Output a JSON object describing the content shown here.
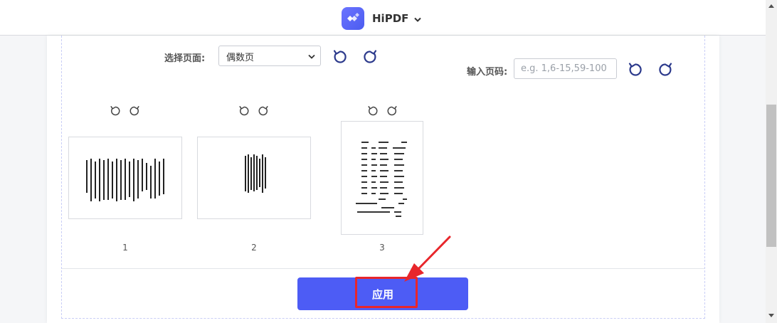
{
  "header": {
    "app_name": "HiPDF"
  },
  "toolbar": {
    "select_pages_label": "选择页面:",
    "select_value": "偶数页",
    "page_input_label": "输入页码:",
    "page_input_placeholder": "e.g. 1,6-15,59-100"
  },
  "pages": [
    {
      "number": "1",
      "orientation": "landscape"
    },
    {
      "number": "2",
      "orientation": "landscape"
    },
    {
      "number": "3",
      "orientation": "portrait"
    }
  ],
  "apply_button": {
    "label": "应用"
  },
  "colors": {
    "accent": "#4d5cf5",
    "annotation_red": "#e8262b",
    "rotate_icon": "#2c3a8c"
  }
}
